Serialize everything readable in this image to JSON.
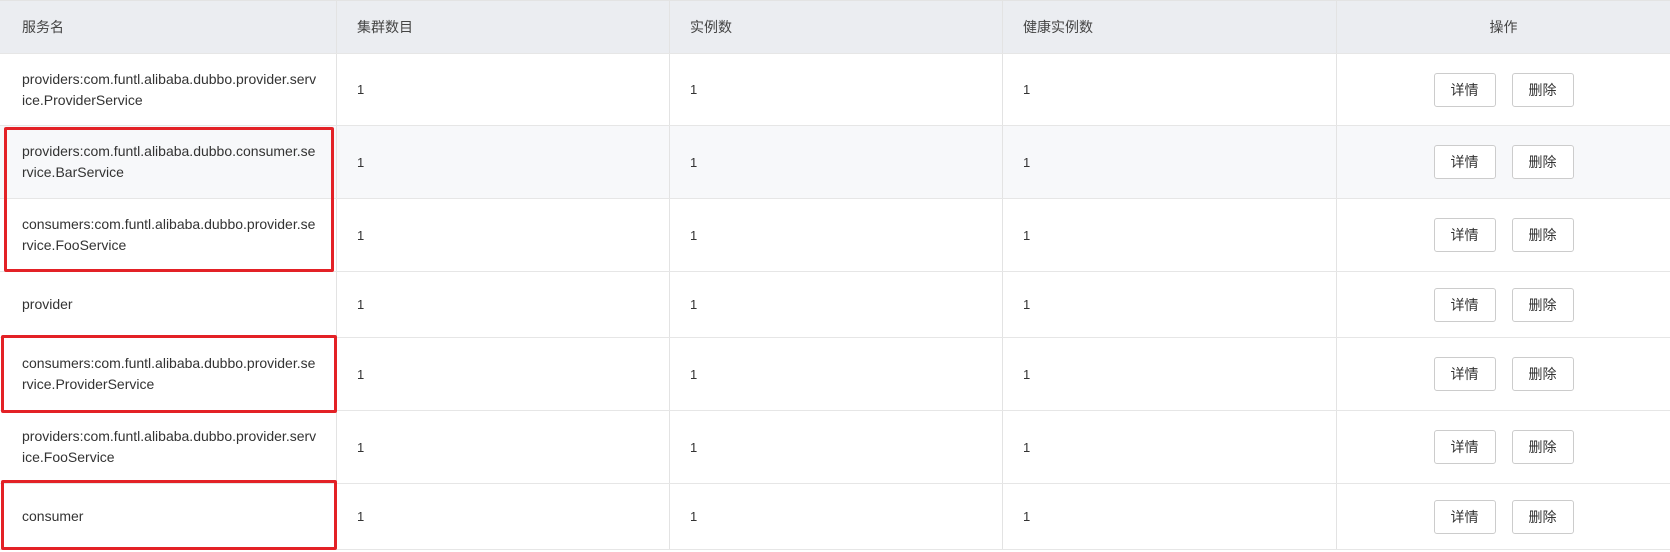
{
  "table": {
    "headers": {
      "service": "服务名",
      "clusters": "集群数目",
      "instances": "实例数",
      "healthy": "健康实例数",
      "actions": "操作"
    },
    "rows": [
      {
        "service": "providers:com.funtl.alibaba.dubbo.provider.service.ProviderService",
        "clusters": "1",
        "instances": "1",
        "healthy": "1",
        "detail": "详情",
        "delete": "删除"
      },
      {
        "service": "providers:com.funtl.alibaba.dubbo.consumer.service.BarService",
        "clusters": "1",
        "instances": "1",
        "healthy": "1",
        "detail": "详情",
        "delete": "删除"
      },
      {
        "service": "consumers:com.funtl.alibaba.dubbo.provider.service.FooService",
        "clusters": "1",
        "instances": "1",
        "healthy": "1",
        "detail": "详情",
        "delete": "删除"
      },
      {
        "service": "provider",
        "clusters": "1",
        "instances": "1",
        "healthy": "1",
        "detail": "详情",
        "delete": "删除"
      },
      {
        "service": "consumers:com.funtl.alibaba.dubbo.provider.service.ProviderService",
        "clusters": "1",
        "instances": "1",
        "healthy": "1",
        "detail": "详情",
        "delete": "删除"
      },
      {
        "service": "providers:com.funtl.alibaba.dubbo.provider.service.FooService",
        "clusters": "1",
        "instances": "1",
        "healthy": "1",
        "detail": "详情",
        "delete": "删除"
      },
      {
        "service": "consumer",
        "clusters": "1",
        "instances": "1",
        "healthy": "1",
        "detail": "详情",
        "delete": "删除"
      }
    ]
  },
  "colors": {
    "header_bg": "#ebedf1",
    "highlight": "#e32126",
    "row_alt_bg": "#f7f8fa"
  }
}
